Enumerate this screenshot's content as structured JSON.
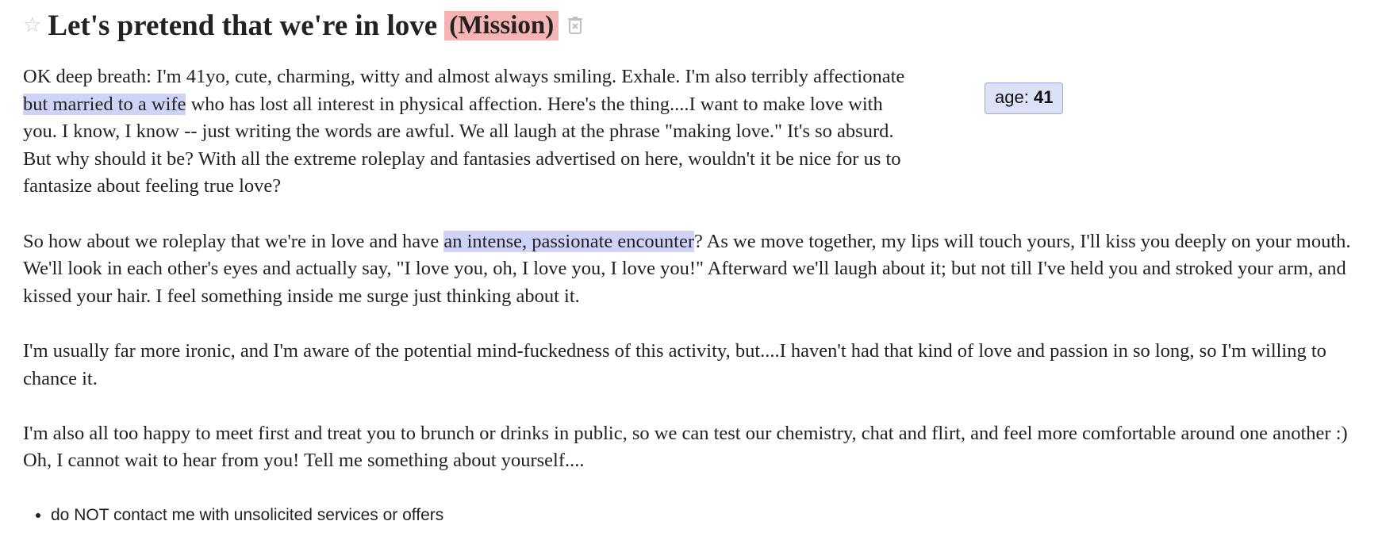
{
  "post": {
    "title": "Let's pretend that we're in love",
    "category_tag": "(Mission)",
    "age_label": "age:",
    "age_value": "41"
  },
  "body": {
    "p1_a": "OK deep breath: I'm 41yo, cute, charming, witty and almost always smiling. Exhale. I'm also terribly affectionate ",
    "p1_hl": "but married to a wife",
    "p1_b": " who has lost all interest in physical affection. Here's the thing....I want to make love with you. I know, I know -- just writing the words are awful. We all laugh at the phrase \"making love.\" It's so absurd. But why should it be? With all the extreme roleplay and fantasies advertised on here, wouldn't it be nice for us to fantasize about feeling true love?",
    "p2_a": "So how about we roleplay that we're in love and have ",
    "p2_hl": "an intense, passionate encounter",
    "p2_b": "? As we move together, my lips will touch yours, I'll kiss you deeply on your mouth. We'll look in each other's eyes and actually say, \"I love you, oh, I love you, I love you!\" Afterward we'll laugh about it; but not till I've held you and stroked your arm, and kissed your hair. I feel something inside me surge just thinking about it.",
    "p3": "I'm usually far more ironic, and I'm aware of the potential mind-fuckedness of this activity, but....I haven't had that kind of love and passion in so long, so I'm willing to chance it.",
    "p4": "I'm also all too happy to meet first and treat you to brunch or drinks in public, so we can test our chemistry, chat and flirt, and feel more comfortable around one another :) Oh, I cannot wait to hear from you! Tell me something about yourself...."
  },
  "notices": [
    "do NOT contact me with unsolicited services or offers"
  ],
  "icons": {
    "favorite": "star-icon",
    "hide": "trash-icon"
  },
  "colors": {
    "tag_bg": "#f5b5b5",
    "highlight": "#cfd3f7",
    "badge_bg": "#dde1f8"
  }
}
